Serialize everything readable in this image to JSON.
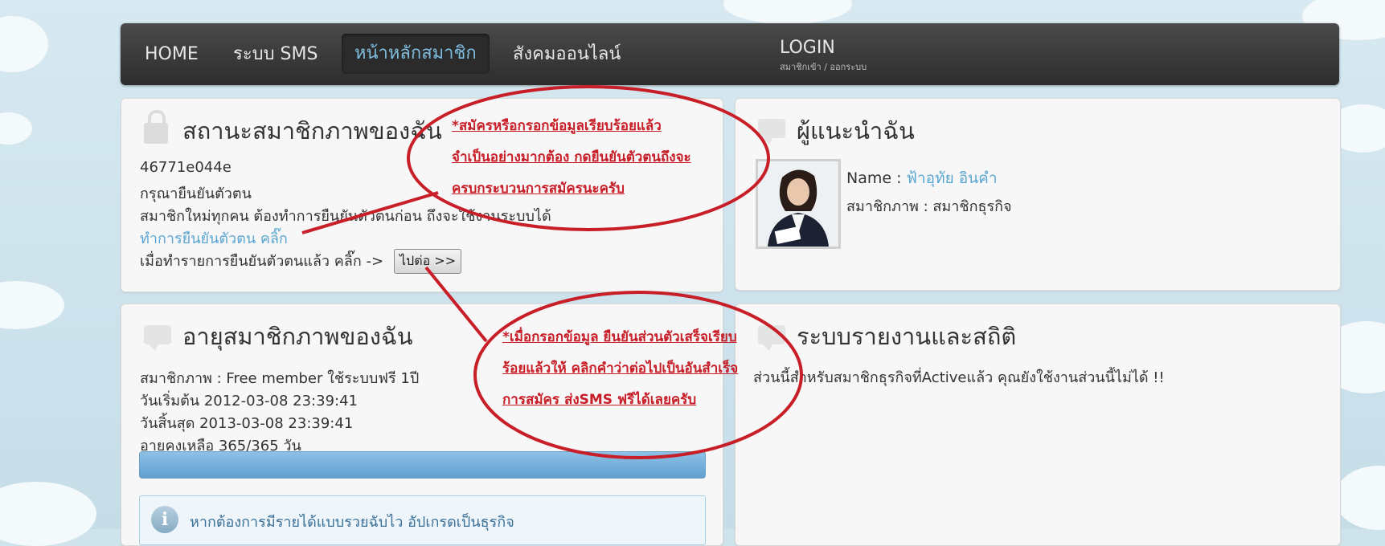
{
  "nav": {
    "home": "HOME",
    "sms": "ระบบ SMS",
    "member_home": "หน้าหลักสมาชิก",
    "social": "สังคมออนไลน์",
    "login": "LOGIN",
    "login_sub": "สมาชิกเข้า / ออกระบบ"
  },
  "status_panel": {
    "title": "สถานะสมาชิกภาพของฉัน",
    "code": "46771e044e",
    "line1": "กรุณายืนยันตัวตน",
    "line2": "สมาชิกใหม่ทุกคน ต้องทำการยืนยันตัวตนก่อน ถึงจะใช้งานระบบได้",
    "verify_link": "ทำการยืนยันตัวตน คลิ๊ก",
    "after_text": "เมื่อทำรายการยืนยันตัวตนแล้ว คลิ๊ก ->",
    "next_button": "ไปต่อ >>"
  },
  "referrer_panel": {
    "title": "ผู้แนะนำฉัน",
    "name_label": "Name :",
    "name_value": "ฟ้าอุทัย อินคำ",
    "membership": "สมาชิกภาพ : สมาชิกธุรกิจ"
  },
  "age_panel": {
    "title": "อายุสมาชิกภาพของฉัน",
    "line1": "สมาชิกภาพ : Free member ใช้ระบบฟรี 1ปี",
    "line2": "วันเริ่มต้น 2012-03-08 23:39:41",
    "line3": "วันสิ้นสุด 2013-03-08 23:39:41",
    "line4": "อายุคงเหลือ 365/365 วัน",
    "remaining_fraction": 1.0,
    "info_text": "หากต้องการมีรายได้แบบรวยฉับไว อัปเกรดเป็นธุรกิจ"
  },
  "report_panel": {
    "title": "ระบบรายงานและสถิติ",
    "line1": "ส่วนนี้สำหรับสมาชิกธุรกิจที่Activeแล้ว คุณยังใช้งานส่วนนี้ไม่ได้ !!"
  },
  "annotations": {
    "top": [
      "*สมัครหรือกรอกข้อมูลเรียบร้อยแล้ว",
      "จำเป็นอย่างมากต้อง กดยืนยันตัวตนถึงจะ",
      "ครบกระบวนการสมัครนะครับ"
    ],
    "bottom": [
      "*เมื่อกรอกข้อมูล ยืนยันส่วนตัวเสร็จเรียบ",
      "ร้อยแล้วให้ คลิกคำว่าต่อไปเป็นอันสำเร็จ",
      "การสมัคร ส่งSMS ฟรีได้เลยครับ"
    ]
  },
  "colors": {
    "annotation_red": "#c81e28",
    "link_blue": "#5aa6d3",
    "nav_active": "#7fbde0"
  }
}
